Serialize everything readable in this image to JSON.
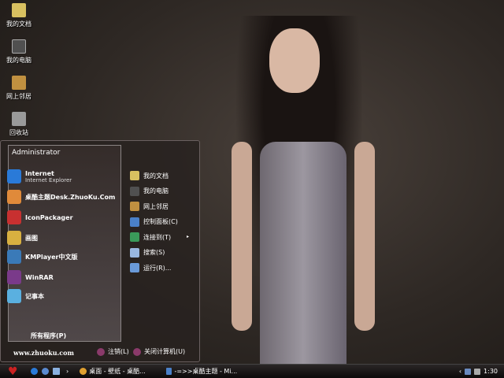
{
  "desktop_icons": [
    {
      "label": "我的文档",
      "icon": "folder-icon"
    },
    {
      "label": "我的电脑",
      "icon": "computer-icon"
    },
    {
      "label": "网上邻居",
      "icon": "network-icon"
    },
    {
      "label": "回收站",
      "icon": "recycle-bin-icon"
    }
  ],
  "start_menu": {
    "user": "Administrator",
    "programs": [
      {
        "label": "Internet",
        "sub": "Internet Explorer",
        "color": "#2a7ad8"
      },
      {
        "label": "桌酷主题Desk.ZhuoKu.Com",
        "color": "#e08a3a"
      },
      {
        "label": "IconPackager",
        "color": "#c83030"
      },
      {
        "label": "画图",
        "color": "#d8b040"
      },
      {
        "label": "KMPlayer中文版",
        "color": "#3a7ab8"
      },
      {
        "label": "WinRAR",
        "color": "#7a3a8a"
      },
      {
        "label": "记事本",
        "color": "#5ab0e0"
      }
    ],
    "all_programs": "所有程序(P)",
    "places": [
      {
        "label": "我的文档",
        "color": "#d8c060"
      },
      {
        "label": "我的电脑",
        "color": "#505050"
      },
      {
        "label": "网上邻居",
        "color": "#c09040"
      },
      {
        "label": "控制面板(C)",
        "color": "#4a80c8"
      },
      {
        "label": "连接到(T)",
        "color": "#3a9a5a"
      },
      {
        "label": "搜索(S)",
        "color": "#9ab8e0"
      },
      {
        "label": "运行(R)...",
        "color": "#6a9ad8"
      }
    ],
    "connect_arrow": "▸",
    "website": "www.zhuoku.com",
    "logoff": "注销(L)",
    "shutdown": "关闭计算机(U)"
  },
  "taskbar": {
    "start_icon": "♥",
    "tasks": [
      {
        "label": "桌面 - 壁纸 - 桌酷...",
        "color": "#e0a030"
      },
      {
        "label": "-=>>桌酷主题 - Mi...",
        "color": "#4a80c8"
      }
    ],
    "chevron": "›",
    "clock": "1:30"
  }
}
